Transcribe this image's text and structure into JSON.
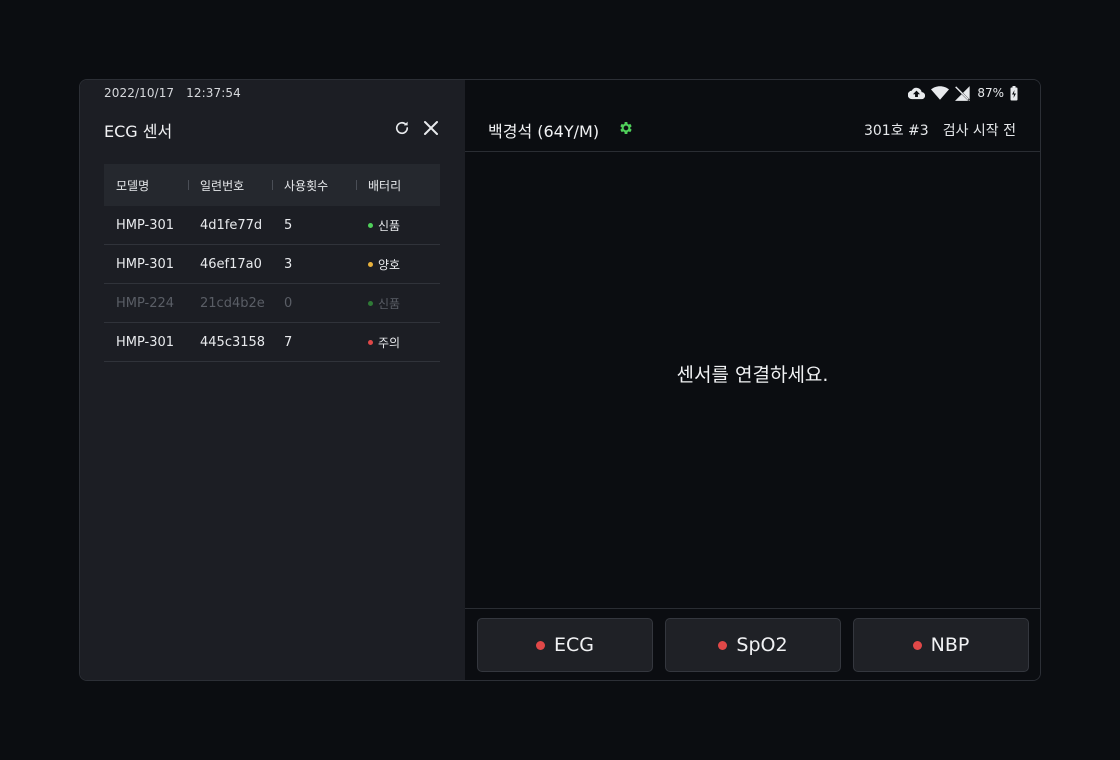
{
  "status": {
    "date": "2022/10/17",
    "time": "12:37:54",
    "battery": "87%"
  },
  "sensor_panel": {
    "title": "ECG 센서",
    "columns": [
      "모델명",
      "일련번호",
      "사용횟수",
      "배터리"
    ],
    "rows": [
      {
        "model": "HMP-301",
        "serial": "4d1fe77d",
        "count": "5",
        "battery": "신품",
        "battery_color": "#4fd05a",
        "disabled": false
      },
      {
        "model": "HMP-301",
        "serial": "46ef17a0",
        "count": "3",
        "battery": "양호",
        "battery_color": "#e8b13c",
        "disabled": false
      },
      {
        "model": "HMP-224",
        "serial": "21cd4b2e",
        "count": "0",
        "battery": "신품",
        "battery_color": "#2f7a36",
        "disabled": true
      },
      {
        "model": "HMP-301",
        "serial": "445c3158",
        "count": "7",
        "battery": "주의",
        "battery_color": "#e04848",
        "disabled": false
      }
    ]
  },
  "patient": {
    "name": "백경석 (64Y/M)",
    "room": "301호 #3",
    "exam_status": "검사 시작 전"
  },
  "main": {
    "message": "센서를 연결하세요."
  },
  "sensor_buttons": [
    {
      "label": "ECG",
      "status_color": "#e04848"
    },
    {
      "label": "SpO2",
      "status_color": "#e04848"
    },
    {
      "label": "NBP",
      "status_color": "#e04848"
    }
  ],
  "colors": {
    "accent_green": "#4fd05a",
    "alert_red": "#e04848"
  }
}
